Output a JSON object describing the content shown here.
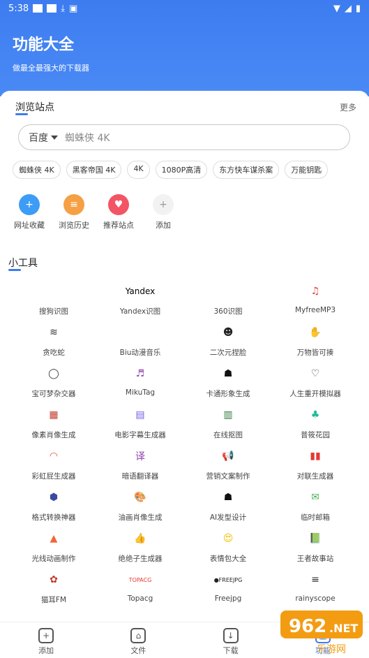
{
  "status": {
    "time": "5:38"
  },
  "header": {
    "title": "功能大全",
    "subtitle": "做最全最强大的下载器"
  },
  "browse": {
    "title": "浏览站点",
    "more": "更多",
    "search": {
      "engine": "百度",
      "value": "蜘蛛侠 4K"
    },
    "tags": [
      "蜘蛛侠 4K",
      "黑客帝国 4K",
      "4K",
      "1080P高清",
      "东方快车谋杀案",
      "万能钥匙"
    ],
    "quick": [
      {
        "label": "网址收藏",
        "icon": "bookmark-add-icon",
        "color": "#3d9cf5"
      },
      {
        "label": "浏览历史",
        "icon": "history-layers-icon",
        "color": "#f5a044"
      },
      {
        "label": "推荐站点",
        "icon": "heart-icon",
        "color": "#f25563"
      },
      {
        "label": "添加",
        "icon": "plus-icon",
        "color": "#f2f2f2"
      }
    ]
  },
  "tools": {
    "title": "小工具",
    "items": [
      {
        "label": "搜狗识图",
        "icon": "sogou-icon",
        "text": "",
        "color": "#ffffff"
      },
      {
        "label": "Yandex识图",
        "icon": "yandex-icon",
        "text": "Yandex",
        "color": "#ffffff"
      },
      {
        "label": "360识图",
        "icon": "360-icon",
        "text": "",
        "color": "#ffffff"
      },
      {
        "label": "MyfreeMP3",
        "icon": "music-note-icon",
        "text": "♫",
        "color": "#e53935"
      },
      {
        "label": "贪吃蛇",
        "icon": "snake-icon",
        "text": "≋",
        "color": "#333333"
      },
      {
        "label": "Biu动漫音乐",
        "icon": "biu-music-icon",
        "text": "",
        "color": "#ffffff"
      },
      {
        "label": "二次元捏脸",
        "icon": "anime-face-icon",
        "text": "☻",
        "color": "#222222"
      },
      {
        "label": "万物皆可揍",
        "icon": "hand-icon",
        "text": "✋",
        "color": "#555555"
      },
      {
        "label": "宝可梦杂交器",
        "icon": "egg-icon",
        "text": "◯",
        "color": "#444444"
      },
      {
        "label": "MikuTag",
        "icon": "headphones-icon",
        "text": "♬",
        "color": "#8e44ad"
      },
      {
        "label": "卡通形象生成",
        "icon": "ghost-icon",
        "text": "☗",
        "color": "#111111"
      },
      {
        "label": "人生重开模拟器",
        "icon": "heart-head-icon",
        "text": "♡",
        "color": "#333333"
      },
      {
        "label": "像素肖像生成",
        "icon": "pixel-mario-icon",
        "text": "▦",
        "color": "#c0392b"
      },
      {
        "label": "电影字幕生成器",
        "icon": "film-icon",
        "text": "▤",
        "color": "#6c5ce7"
      },
      {
        "label": "在线抠图",
        "icon": "cutout-icon",
        "text": "▥",
        "color": "#2d7a3a"
      },
      {
        "label": "普筱花园",
        "icon": "garden-icon",
        "text": "♣",
        "color": "#1abc9c"
      },
      {
        "label": "彩虹屁生成器",
        "icon": "rainbow-icon",
        "text": "◠",
        "color": "#e74c3c"
      },
      {
        "label": "暗语翻译器",
        "icon": "translate-icon",
        "text": "译",
        "color": "#8e44ad"
      },
      {
        "label": "营销文案制作",
        "icon": "megaphone-icon",
        "text": "📢",
        "color": "#e74c3c"
      },
      {
        "label": "对联生成器",
        "icon": "couplet-icon",
        "text": "▮▮",
        "color": "#e53935"
      },
      {
        "label": "格式转换神器",
        "icon": "cube-icon",
        "text": "⬢",
        "color": "#3b4a9e"
      },
      {
        "label": "油画肖像生成",
        "icon": "palette-icon",
        "text": "🎨",
        "color": "#e67e22"
      },
      {
        "label": "AI发型设计",
        "icon": "hairstyle-icon",
        "text": "☗",
        "color": "#111111"
      },
      {
        "label": "临时邮箱",
        "icon": "mail-icon",
        "text": "✉",
        "color": "#4caf50"
      },
      {
        "label": "光线动画制作",
        "icon": "image-icon",
        "text": "▲",
        "color": "#f0643c"
      },
      {
        "label": "绝绝子生成器",
        "icon": "thumbs-up-icon",
        "text": "👍",
        "color": "#1e5bd6"
      },
      {
        "label": "表情包大全",
        "icon": "emoji-icon",
        "text": "😍",
        "color": "#f1c40f"
      },
      {
        "label": "王者故事站",
        "icon": "book-icon",
        "text": "📗",
        "color": "#27ae60"
      },
      {
        "label": "猫耳FM",
        "icon": "cat-fm-icon",
        "text": "✿",
        "color": "#c0392b"
      },
      {
        "label": "Topacg",
        "icon": "topacg-icon",
        "text": "TOPACG",
        "color": "#e53935"
      },
      {
        "label": "Freejpg",
        "icon": "freejpg-icon",
        "text": "●FREEJPG",
        "color": "#222222"
      },
      {
        "label": "rainyscope",
        "icon": "rainyscope-icon",
        "text": "≡",
        "color": "#333333"
      }
    ]
  },
  "nav": [
    {
      "label": "添加",
      "icon": "add-square-icon",
      "glyph": "+"
    },
    {
      "label": "文件",
      "icon": "home-file-icon",
      "glyph": "⌂"
    },
    {
      "label": "下载",
      "icon": "download-icon",
      "glyph": "↓"
    },
    {
      "label": "功能",
      "icon": "grid-icon",
      "glyph": "▦",
      "active": true
    }
  ],
  "watermark": {
    "brand": "962",
    "suffix": ".NET",
    "site": "乐游网"
  }
}
